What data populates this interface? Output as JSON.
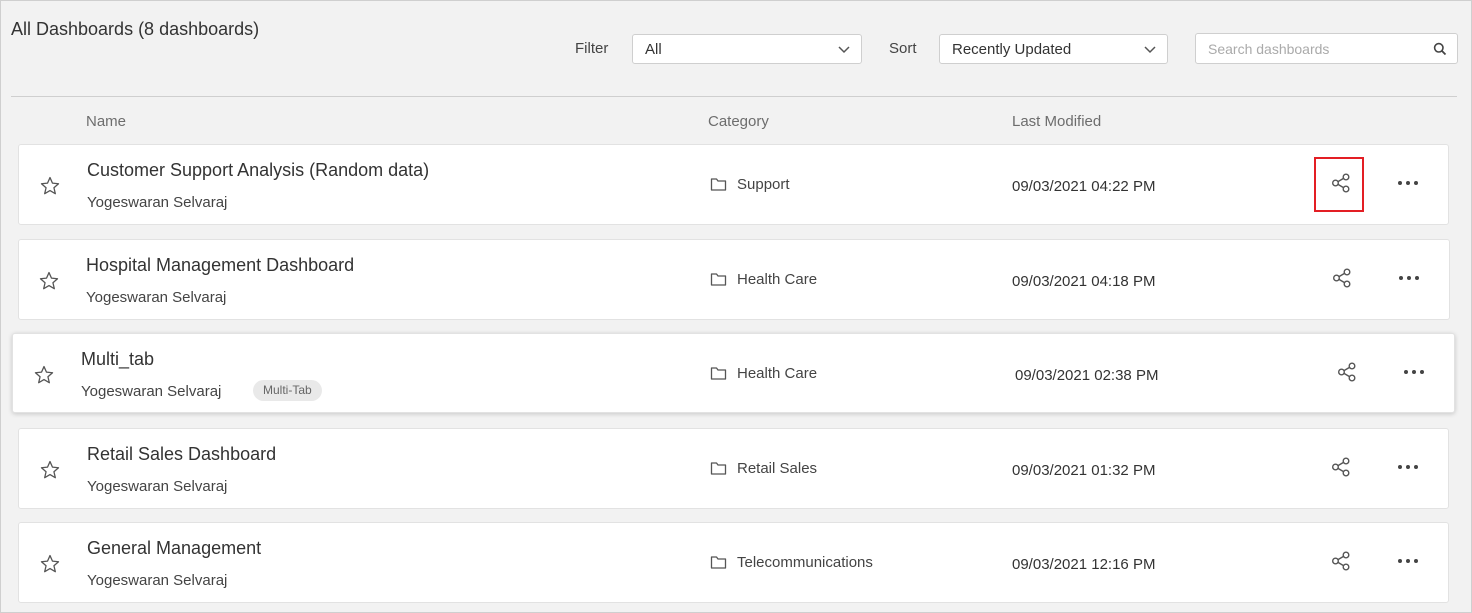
{
  "header": {
    "title": "All Dashboards (8 dashboards)"
  },
  "filter": {
    "label": "Filter",
    "value": "All"
  },
  "sort": {
    "label": "Sort",
    "value": "Recently Updated"
  },
  "search": {
    "placeholder": "Search dashboards"
  },
  "columns": {
    "name": "Name",
    "category": "Category",
    "modified": "Last Modified"
  },
  "rows": [
    {
      "name": "Customer Support Analysis (Random data)",
      "owner": "Yogeswaran Selvaraj",
      "category": "Support",
      "modified": "09/03/2021 04:22 PM"
    },
    {
      "name": "Hospital Management Dashboard",
      "owner": "Yogeswaran Selvaraj",
      "category": "Health Care",
      "modified": "09/03/2021 04:18 PM"
    },
    {
      "name": "Multi_tab",
      "owner": "Yogeswaran Selvaraj",
      "badge": "Multi-Tab",
      "category": "Health Care",
      "modified": "09/03/2021 02:38 PM"
    },
    {
      "name": "Retail Sales Dashboard",
      "owner": "Yogeswaran Selvaraj",
      "category": "Retail Sales",
      "modified": "09/03/2021 01:32 PM"
    },
    {
      "name": "General Management",
      "owner": "Yogeswaran Selvaraj",
      "category": "Telecommunications",
      "modified": "09/03/2021 12:16 PM"
    }
  ],
  "icons": {
    "star": "star-icon",
    "folder": "folder-icon",
    "share": "share-icon",
    "more": "more-icon",
    "search": "search-icon",
    "chevron": "chevron-down-icon"
  },
  "colors": {
    "highlight": "#e31e24"
  }
}
